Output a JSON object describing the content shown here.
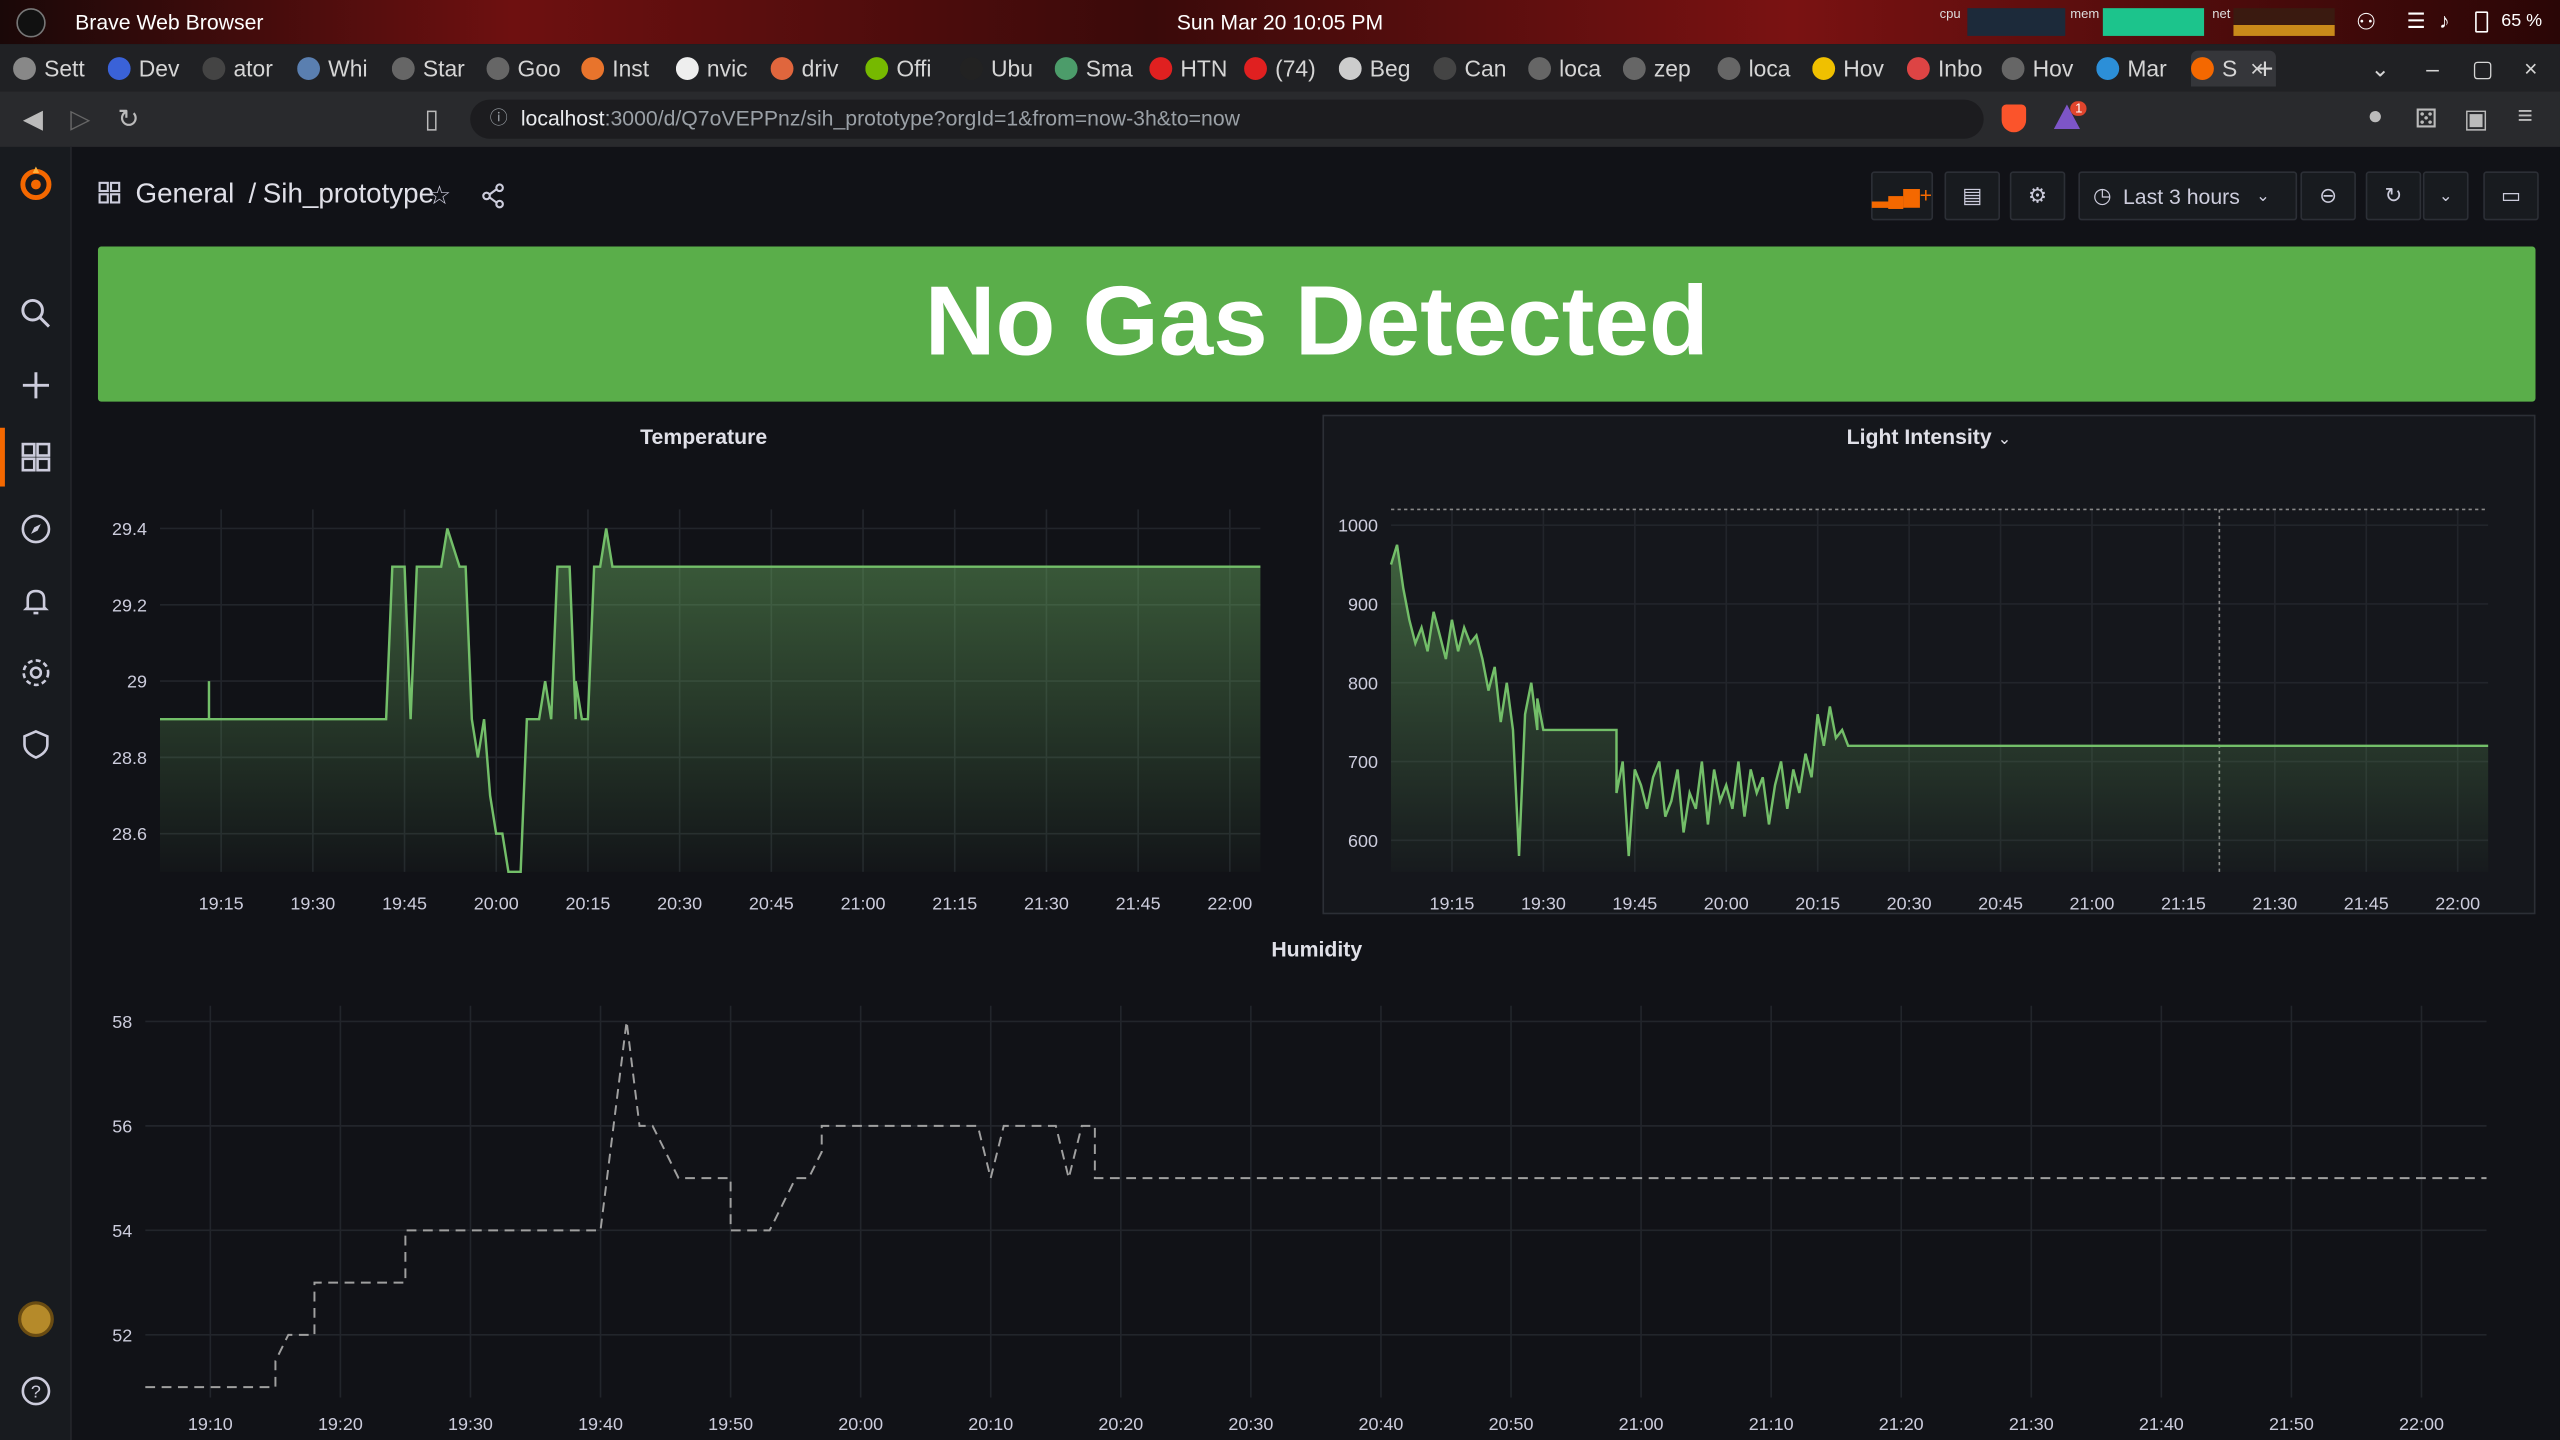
{
  "os": {
    "app_name": "Brave Web Browser",
    "clock": "Sun Mar 20  10:05 PM",
    "cpu_label": "cpu",
    "mem_label": "mem",
    "net_label": "net",
    "battery": "65 %"
  },
  "tabs": [
    {
      "label": "Sett",
      "color": "#888"
    },
    {
      "label": "Dev",
      "color": "#3a62d8"
    },
    {
      "label": "ator",
      "color": "#444"
    },
    {
      "label": "Whi",
      "color": "#5a7fb0"
    },
    {
      "label": "Star",
      "color": "#666"
    },
    {
      "label": "Goo",
      "color": "#666"
    },
    {
      "label": "Inst",
      "color": "#e8742c"
    },
    {
      "label": "nvic",
      "color": "#eee"
    },
    {
      "label": "driv",
      "color": "#e0663d"
    },
    {
      "label": "Offi",
      "color": "#76b900"
    },
    {
      "label": "Ubu",
      "color": "#222"
    },
    {
      "label": "Sma",
      "color": "#4c9c6a"
    },
    {
      "label": "HTN",
      "color": "#e02020"
    },
    {
      "label": "(74)",
      "color": "#e02020"
    },
    {
      "label": "Beg",
      "color": "#ccc"
    },
    {
      "label": "Can",
      "color": "#444"
    },
    {
      "label": "loca",
      "color": "#666"
    },
    {
      "label": "zep",
      "color": "#666"
    },
    {
      "label": "loca",
      "color": "#666"
    },
    {
      "label": "Hov",
      "color": "#f0c000"
    },
    {
      "label": "Inbo",
      "color": "#d44"
    },
    {
      "label": "Hov",
      "color": "#666"
    },
    {
      "label": "Mar",
      "color": "#2c8fd8"
    },
    {
      "label": "S",
      "color": "#f46800"
    }
  ],
  "address": {
    "host": "localhost",
    "path": ":3000/d/Q7oVEPPnz/sih_prototype?orgId=1&from=now-3h&to=now",
    "badge": "1"
  },
  "breadcrumb": {
    "folder": "General",
    "separator": "/",
    "dashboard": "Sih_prototype"
  },
  "toolbar": {
    "time_range": "Last 3 hours"
  },
  "alert": {
    "text": "No Gas Detected",
    "color": "#5aae4a"
  },
  "panels": {
    "temperature": {
      "title": "Temperature"
    },
    "light": {
      "title": "Light Intensity"
    },
    "humidity": {
      "title": "Humidity"
    }
  },
  "chart_data": [
    {
      "type": "line",
      "title": "Temperature",
      "x_unit": "time",
      "x_ticks": [
        "19:15",
        "19:30",
        "19:45",
        "20:00",
        "20:15",
        "20:30",
        "20:45",
        "21:00",
        "21:15",
        "21:30",
        "21:45",
        "22:00"
      ],
      "y_ticks": [
        "28.6",
        "28.8",
        "29",
        "29.2",
        "29.4"
      ],
      "ylim": [
        28.5,
        29.45
      ],
      "xlim": [
        "19:05",
        "22:05"
      ],
      "series": [
        {
          "color": "#73bf69",
          "x": [
            "19:05",
            "19:13",
            "19:13",
            "19:13",
            "19:42",
            "19:43",
            "19:45",
            "19:46",
            "19:47",
            "19:51",
            "19:52",
            "19:54",
            "19:55",
            "19:56",
            "19:57",
            "19:58",
            "19:59",
            "20:00",
            "20:01",
            "20:02",
            "20:03",
            "20:04",
            "20:05",
            "20:06",
            "20:07",
            "20:08",
            "20:09",
            "20:09",
            "20:10",
            "20:12",
            "20:13",
            "20:13",
            "20:14",
            "20:15",
            "20:16",
            "20:17",
            "20:18",
            "20:19",
            "20:20",
            "22:05"
          ],
          "y": [
            28.9,
            28.9,
            29.0,
            28.9,
            28.9,
            29.3,
            29.3,
            28.9,
            29.3,
            29.3,
            29.4,
            29.3,
            29.3,
            28.9,
            28.8,
            28.9,
            28.7,
            28.6,
            28.6,
            28.5,
            28.5,
            28.5,
            28.9,
            28.9,
            28.9,
            29.0,
            28.9,
            28.9,
            29.3,
            29.3,
            28.9,
            29.0,
            28.9,
            28.9,
            29.3,
            29.3,
            29.4,
            29.3,
            29.3,
            29.3
          ],
          "fill": "gradient"
        }
      ]
    },
    {
      "type": "line",
      "title": "Light Intensity",
      "x_unit": "time",
      "x_ticks": [
        "19:15",
        "19:30",
        "19:45",
        "20:00",
        "20:15",
        "20:30",
        "20:45",
        "21:00",
        "21:15",
        "21:30",
        "21:45",
        "22:00"
      ],
      "y_ticks": [
        "600",
        "700",
        "800",
        "900",
        "1000"
      ],
      "ylim": [
        560,
        1020
      ],
      "xlim": [
        "19:05",
        "22:05"
      ],
      "threshold_line": 1020,
      "series": [
        {
          "color": "#73bf69",
          "x": [
            "19:05",
            "19:06",
            "19:07",
            "19:08",
            "19:09",
            "19:10",
            "19:11",
            "19:12",
            "19:13",
            "19:14",
            "19:15",
            "19:16",
            "19:17",
            "19:18",
            "19:19",
            "19:20",
            "19:21",
            "19:22",
            "19:23",
            "19:24",
            "19:25",
            "19:26",
            "19:27",
            "19:28",
            "19:29",
            "19:29",
            "19:30",
            "19:31",
            "19:32",
            "19:33",
            "19:36",
            "19:42",
            "19:42",
            "19:43",
            "19:44",
            "19:45",
            "19:46",
            "19:47",
            "19:48",
            "19:49",
            "19:50",
            "19:51",
            "19:52",
            "19:53",
            "19:54",
            "19:55",
            "19:56",
            "19:57",
            "19:58",
            "19:59",
            "20:00",
            "20:01",
            "20:02",
            "20:03",
            "20:04",
            "20:05",
            "20:06",
            "20:07",
            "20:08",
            "20:09",
            "20:10",
            "20:11",
            "20:12",
            "20:13",
            "20:14",
            "20:15",
            "20:16",
            "20:17",
            "20:18",
            "20:19",
            "20:20",
            "22:05"
          ],
          "y": [
            950,
            975,
            920,
            880,
            850,
            870,
            840,
            890,
            860,
            830,
            880,
            840,
            870,
            850,
            860,
            830,
            790,
            820,
            750,
            800,
            740,
            580,
            760,
            800,
            740,
            780,
            740,
            740,
            740,
            740,
            740,
            740,
            660,
            700,
            580,
            690,
            670,
            640,
            680,
            700,
            630,
            650,
            690,
            610,
            660,
            640,
            700,
            620,
            690,
            650,
            670,
            640,
            700,
            630,
            690,
            660,
            680,
            620,
            670,
            700,
            640,
            690,
            660,
            710,
            680,
            760,
            720,
            770,
            730,
            740,
            720,
            720
          ],
          "fill": "gradient"
        }
      ]
    },
    {
      "type": "line",
      "title": "Humidity",
      "x_unit": "time",
      "x_ticks": [
        "19:10",
        "19:20",
        "19:30",
        "19:40",
        "19:50",
        "20:00",
        "20:10",
        "20:20",
        "20:30",
        "20:40",
        "20:50",
        "21:00",
        "21:10",
        "21:20",
        "21:30",
        "21:40",
        "21:50",
        "22:00"
      ],
      "y_ticks": [
        "52",
        "54",
        "56",
        "58"
      ],
      "ylim": [
        50.8,
        58.3
      ],
      "xlim": [
        "19:05",
        "22:05"
      ],
      "series": [
        {
          "color": "#a0a0a0",
          "dashed": true,
          "x": [
            "19:05",
            "19:15",
            "19:15",
            "19:16",
            "19:17",
            "19:18",
            "19:18",
            "19:25",
            "19:25",
            "19:40",
            "19:41",
            "19:42",
            "19:43",
            "19:44",
            "19:45",
            "19:46",
            "19:46",
            "19:50",
            "19:50",
            "19:53",
            "19:54",
            "19:55",
            "19:56",
            "19:57",
            "19:57",
            "20:09",
            "20:10",
            "20:11",
            "20:11",
            "20:15",
            "20:16",
            "20:17",
            "20:18",
            "20:18",
            "22:05"
          ],
          "y": [
            51,
            51,
            51.5,
            52,
            52,
            52,
            53,
            53,
            54,
            54,
            56,
            58,
            56,
            56,
            55.5,
            55,
            55,
            55,
            54,
            54,
            54.5,
            55,
            55,
            55.5,
            56,
            56,
            55,
            56,
            56,
            56,
            55,
            56,
            56,
            55,
            55
          ]
        }
      ]
    }
  ]
}
